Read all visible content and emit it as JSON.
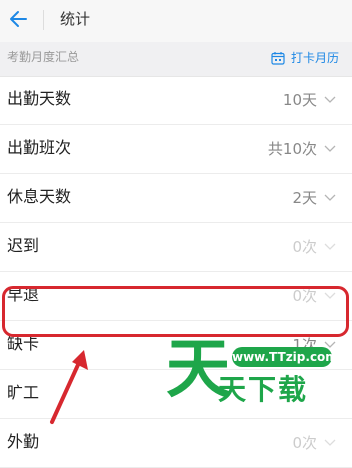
{
  "header": {
    "title": "统计"
  },
  "summary": {
    "label": "考勤月度汇总",
    "calendar_label": "打卡月历"
  },
  "rows": [
    {
      "label": "出勤天数",
      "value": "10天",
      "dim": false
    },
    {
      "label": "出勤班次",
      "value": "共10次",
      "dim": false
    },
    {
      "label": "休息天数",
      "value": "2天",
      "dim": false
    },
    {
      "label": "迟到",
      "value": "0次",
      "dim": true
    },
    {
      "label": "早退",
      "value": "0次",
      "dim": true
    },
    {
      "label": "缺卡",
      "value": "1次",
      "dim": false
    },
    {
      "label": "旷工",
      "value": "",
      "dim": false
    },
    {
      "label": "外勤",
      "value": "0次",
      "dim": true
    }
  ],
  "watermark": {
    "url": "www.TTzip.com",
    "big_char": "天",
    "text": "天下载"
  },
  "colors": {
    "accent": "#1e88e5",
    "highlight": "#d7282f",
    "watermark": "#1ea64a"
  }
}
